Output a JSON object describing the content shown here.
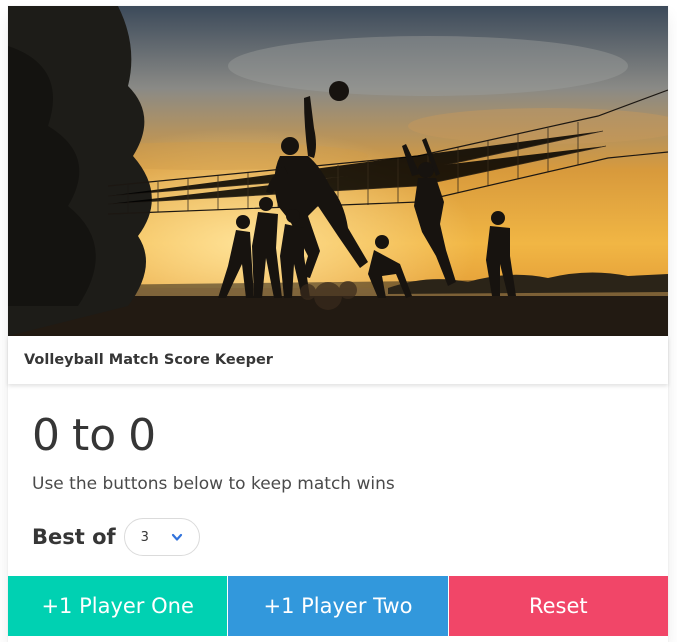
{
  "card": {
    "title": "Volleyball Match Score Keeper",
    "image_alt_icon": "volleyball-silhouette-photo"
  },
  "score": {
    "player_one": "0",
    "separator": "to",
    "player_two": "0"
  },
  "subtitle": "Use the buttons below to keep match wins",
  "best_of": {
    "label": "Best of",
    "selected": "3",
    "chevron_icon": "chevron-down-icon"
  },
  "buttons": {
    "player_one": {
      "label": "+1 Player One",
      "color": "#00d1b2"
    },
    "player_two": {
      "label": "+1 Player Two",
      "color": "#3298dc"
    },
    "reset": {
      "label": "Reset",
      "color": "#f14668"
    }
  }
}
